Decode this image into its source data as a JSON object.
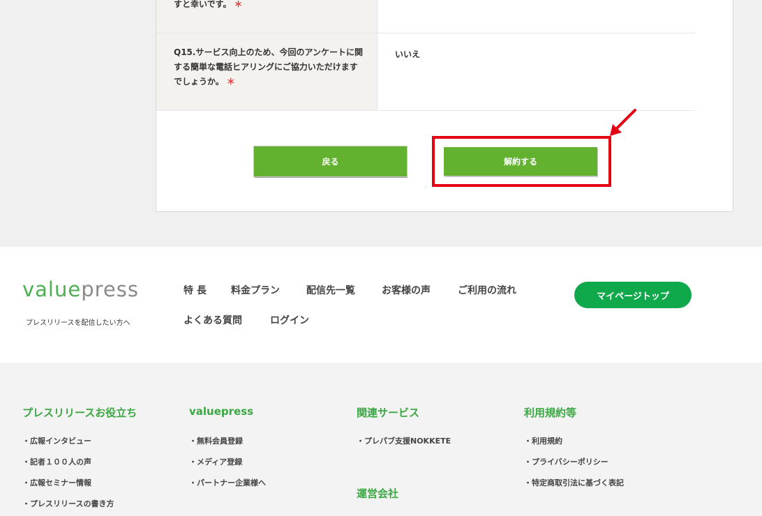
{
  "form": {
    "q14_tail": "すと幸いです。",
    "required_mark": "＊",
    "q15_label": "Q15.サービス向上のため、今回のアンケートに関する簡単な電話ヒアリングにご協力いただけますでしょうか。",
    "q15_answer": "いいえ",
    "back_label": "戻る",
    "cancel_label": "解約する"
  },
  "annotation": {
    "color": "#e50012"
  },
  "footer": {
    "logo_value": "value",
    "logo_press": "press",
    "tagline": "プレスリリースを配信したい方へ",
    "nav": [
      "特 長",
      "料金プラン",
      "配信先一覧",
      "お客様の声",
      "ご利用の流れ",
      "よくある質問",
      "ログイン"
    ],
    "mypage_label": "マイページトップ",
    "columns": [
      {
        "title": "プレスリリースお役立ち",
        "links": [
          "・広報インタビュー",
          "・記者１００人の声",
          "・広報セミナー情報",
          "・プレスリリースの書き方"
        ]
      },
      {
        "title": "valuepress",
        "links": [
          "・無料会員登録",
          "・メディア登録",
          "・パートナー企業様へ"
        ]
      },
      {
        "title": "関連サービス",
        "links": [
          "・プレパブ支援NOKKETE"
        ]
      },
      {
        "title": "利用規約等",
        "links": [
          "・利用規約",
          "・プライバシーポリシー",
          "・特定商取引法に基づく表記"
        ]
      }
    ],
    "company_title": "運営会社"
  },
  "colors": {
    "accent_green": "#62b22f",
    "brand_green": "#0fa84a",
    "title_green": "#3aa742"
  }
}
